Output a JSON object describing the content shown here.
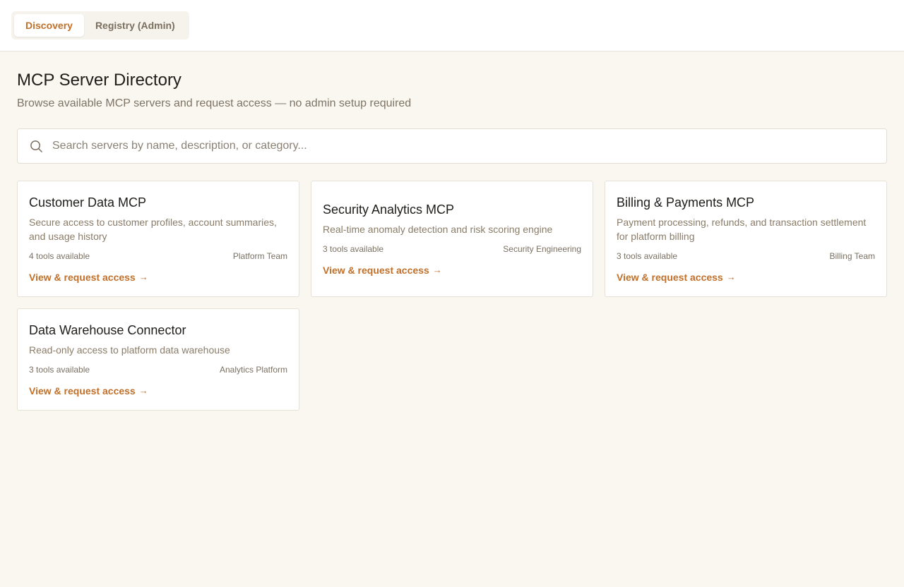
{
  "tabs": [
    {
      "label": "Discovery",
      "active": true
    },
    {
      "label": "Registry (Admin)",
      "active": false
    }
  ],
  "header": {
    "title": "MCP Server Directory",
    "subtitle": "Browse available MCP servers and request access — no admin setup required"
  },
  "search": {
    "placeholder": "Search servers by name, description, or category...",
    "icon": "search-icon"
  },
  "servers": [
    {
      "title": "Customer Data MCP",
      "description": "Secure access to customer profiles, account summaries, and usage history",
      "tools": "4 tools available",
      "owner": "Platform Team",
      "link": "View & request access"
    },
    {
      "title": "Security Analytics MCP",
      "description": "Real-time anomaly detection and risk scoring engine",
      "tools": "3 tools available",
      "owner": "Security Engineering",
      "link": "View & request access"
    },
    {
      "title": "Billing & Payments MCP",
      "description": "Payment processing, refunds, and transaction settlement for platform billing",
      "tools": "3 tools available",
      "owner": "Billing Team",
      "link": "View & request access"
    },
    {
      "title": "Data Warehouse Connector",
      "description": "Read-only access to platform data warehouse",
      "tools": "3 tools available",
      "owner": "Analytics Platform",
      "link": "View & request access"
    }
  ],
  "colors": {
    "accent": "#c0702a",
    "background": "#faf7f0",
    "muted_text": "#8a7c68"
  },
  "arrow_glyph": "→"
}
